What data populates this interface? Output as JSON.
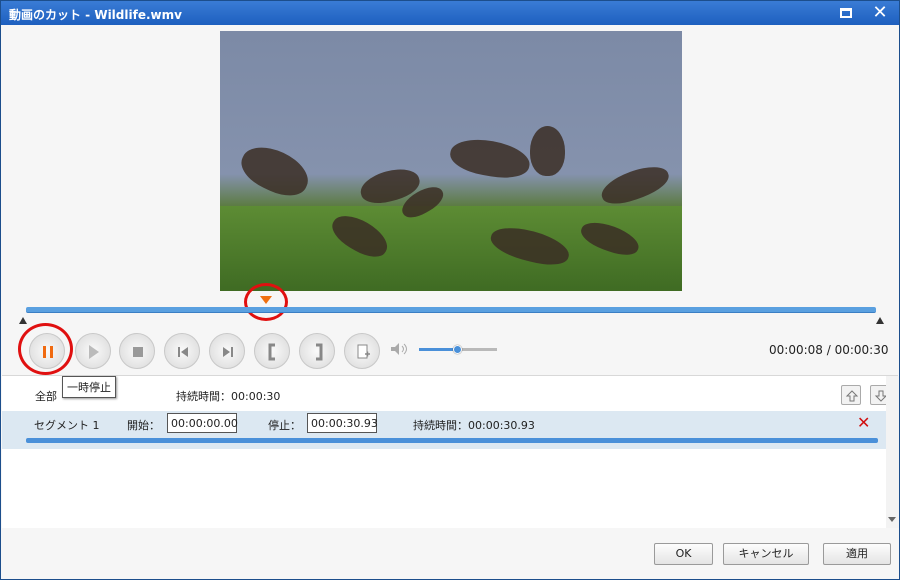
{
  "window": {
    "title": "動画のカット - Wildlife.wmv"
  },
  "player": {
    "time_display": "00:00:08 / 00:00:30",
    "volume_level": 0.5,
    "tooltip": "一時停止"
  },
  "controls": {
    "icons": [
      "pause-icon",
      "play-segment-icon",
      "stop-icon",
      "previous-icon",
      "next-icon",
      "set-start-icon",
      "set-end-icon",
      "add-segment-icon"
    ]
  },
  "summary": {
    "all_label": "全部",
    "duration": "持続時間：00:00:30"
  },
  "segments": [
    {
      "name": "セグメント 1",
      "start_label": "開始：",
      "start_value": "00:00:00.00",
      "end_label": "停止：",
      "end_value": "00:00:30.93",
      "duration": "持続時間：00:00:30.93"
    }
  ],
  "footer": {
    "ok": "OK",
    "cancel": "キャンセル",
    "apply": "適用"
  },
  "colors": {
    "accent": "#4a90d9",
    "highlight": "#e01010",
    "marker": "#f07010"
  }
}
